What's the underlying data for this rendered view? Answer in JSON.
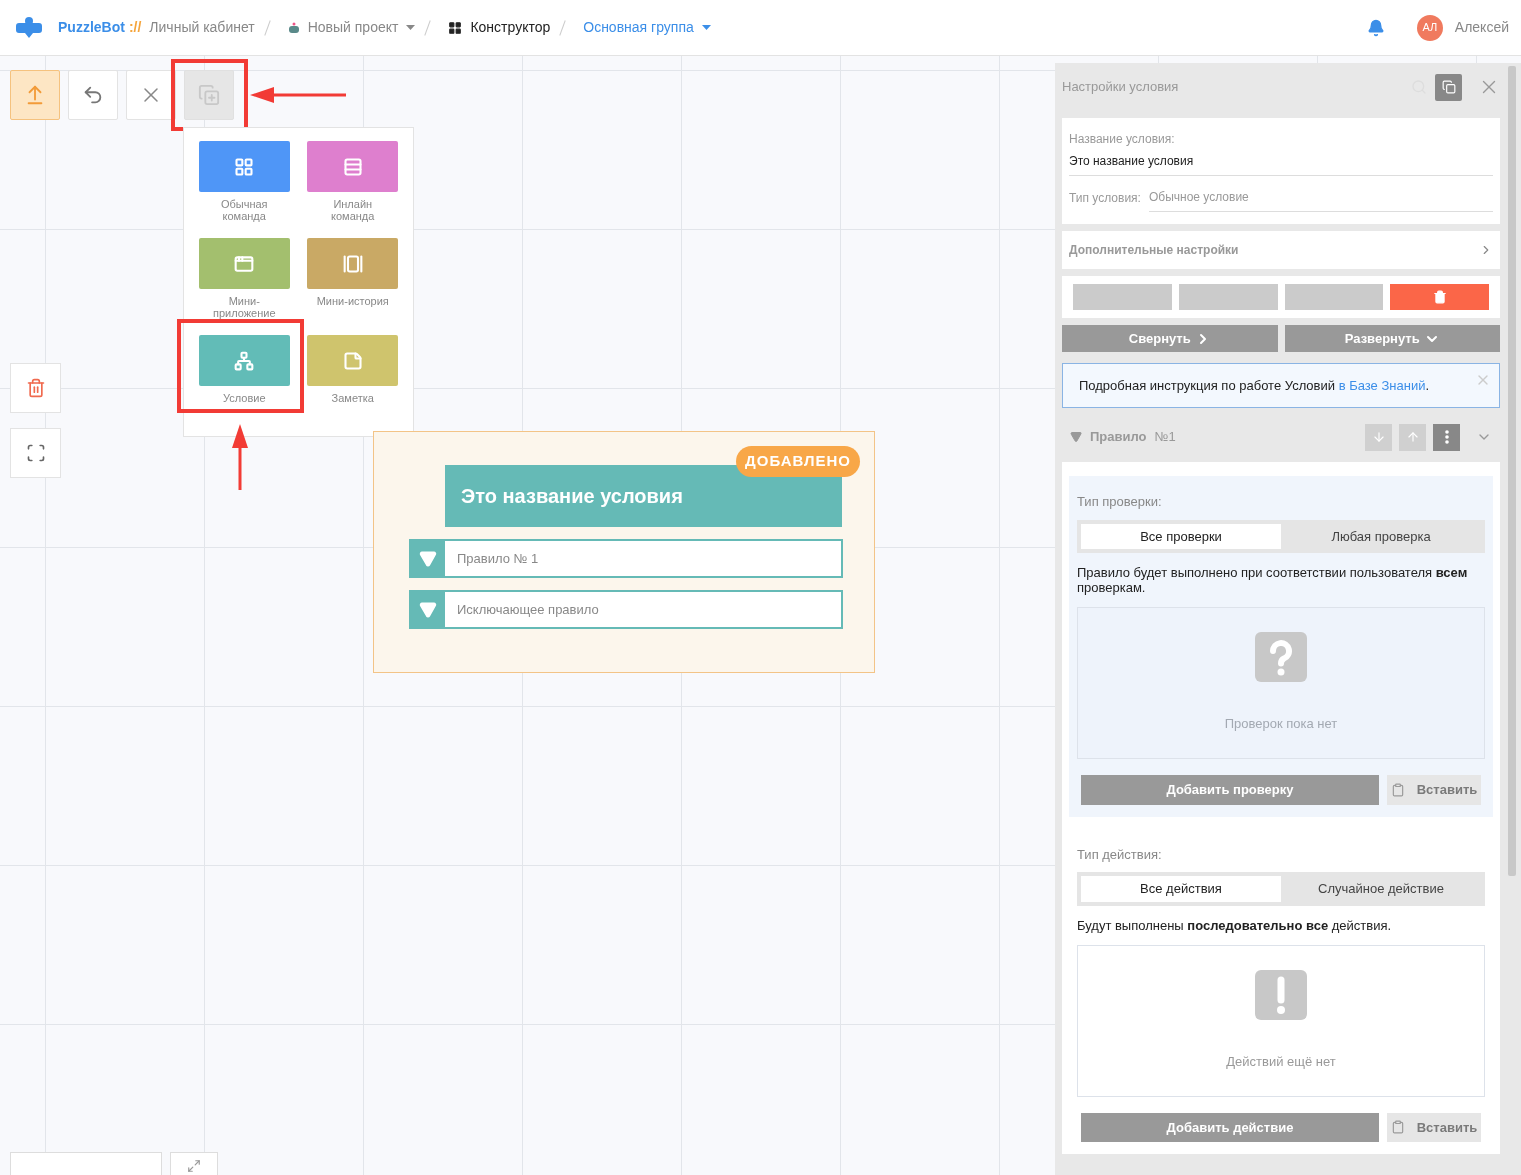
{
  "header": {
    "brand": "PuzzleBot",
    "brand_sep": "://",
    "breadcrumbs": [
      {
        "label": "Личный кабинет",
        "kind": "link"
      },
      {
        "label": "Новый проект",
        "kind": "project"
      },
      {
        "label": "Конструктор",
        "kind": "current"
      },
      {
        "label": "Основная группа",
        "kind": "group"
      }
    ],
    "user": {
      "initials": "АЛ",
      "name": "Алексей"
    }
  },
  "toolbar": [
    {
      "kind": "upload",
      "selected": true
    },
    {
      "kind": "undo",
      "selected": false
    },
    {
      "kind": "close",
      "selected": false
    },
    {
      "kind": "add",
      "selected": true
    }
  ],
  "add_menu": {
    "items": [
      {
        "label": "Обычная команда",
        "kind": "grid",
        "color": "#4f96f7"
      },
      {
        "label": "Инлайн команда",
        "kind": "inline",
        "color": "#de7fce"
      },
      {
        "label": "Мини-приложение",
        "kind": "app",
        "color": "#a3bf6e"
      },
      {
        "label": "Мини-история",
        "kind": "story",
        "color": "#c9a965"
      },
      {
        "label": "Условие",
        "kind": "condition",
        "color": "#62bcb7"
      },
      {
        "label": "Заметка",
        "kind": "note",
        "color": "#cfc46d"
      }
    ]
  },
  "node": {
    "title": "Это название условия",
    "badge": "ДОБАВЛЕНО",
    "rules": [
      "Правило № 1",
      "Исключающее правило"
    ]
  },
  "panel": {
    "title": "Настройки условия",
    "name_label": "Название условия:",
    "name_value": "Это название условия",
    "type_label": "Тип условия:",
    "type_value": "Обычное условие",
    "extra": "Дополнительные настройки",
    "collapse": "Свернуть",
    "expand": "Развернуть",
    "info": {
      "text": "Подробная инструкция по работе Условий",
      "link": "в Базе Знаний",
      "end": "."
    },
    "rule": {
      "title": "Правило",
      "number": "№1"
    },
    "sections": [
      {
        "label": "Тип проверки:",
        "segments": [
          {
            "label": "Все проверки",
            "selected": true
          },
          {
            "label": "Любая проверка",
            "selected": false
          }
        ],
        "description": "Правило будет выполнено при соответствии пользователя **всем** проверкам.",
        "kind": "checks",
        "empty": "Проверок пока нет",
        "add": "Добавить проверку",
        "paste": "Вставить"
      },
      {
        "label": "Тип действия:",
        "segments": [
          {
            "label": "Все действия",
            "selected": true
          },
          {
            "label": "Случайное действие",
            "selected": false
          }
        ],
        "description": "Будут выполнены **последовательно все** действия.",
        "kind": "actions",
        "empty": "Действий ещё нет",
        "add": "Добавить действие",
        "paste": "Вставить"
      }
    ]
  }
}
